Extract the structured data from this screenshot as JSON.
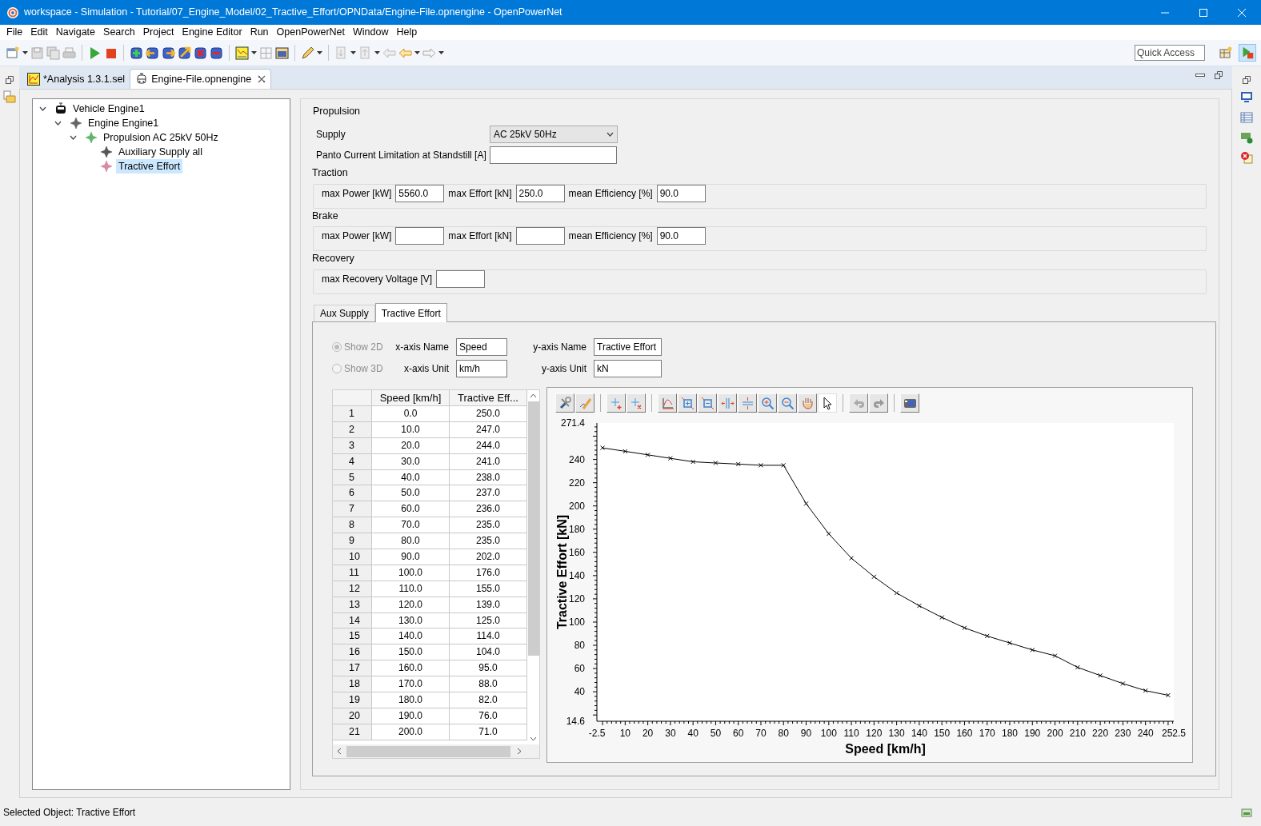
{
  "window": {
    "title": "workspace - Simulation - Tutorial/07_Engine_Model/02_Tractive_Effort/OPNData/Engine-File.opnengine - OpenPowerNet"
  },
  "menu": [
    "File",
    "Edit",
    "Navigate",
    "Search",
    "Project",
    "Engine Editor",
    "Run",
    "OpenPowerNet",
    "Window",
    "Help"
  ],
  "quick_access": {
    "placeholder": "Quick Access"
  },
  "editor_tabs": [
    {
      "label": "*Analysis 1.3.1.sel",
      "kind": "analysis",
      "selected": false
    },
    {
      "label": "Engine-File.opnengine",
      "kind": "engine",
      "selected": true
    }
  ],
  "tree": [
    {
      "label": "Vehicle Engine1",
      "kind": "vehicle",
      "expanded": true,
      "selected": false,
      "children": [
        {
          "label": "Engine Engine1",
          "kind": "engine",
          "expanded": true,
          "selected": false,
          "children": [
            {
              "label": "Propulsion AC 25kV 50Hz",
              "kind": "propulsion",
              "expanded": true,
              "selected": false,
              "children": [
                {
                  "label": "Auxiliary Supply all",
                  "kind": "auxiliary",
                  "selected": false
                },
                {
                  "label": "Tractive Effort",
                  "kind": "tractive",
                  "selected": true
                }
              ]
            }
          ]
        }
      ]
    }
  ],
  "form": {
    "title": "Propulsion",
    "supply": {
      "label": "Supply",
      "value": "AC 25kV 50Hz"
    },
    "panto": {
      "label": "Panto Current Limitation at Standstill [A]"
    },
    "groups": [
      {
        "title": "Traction",
        "fields": [
          {
            "label": "max Power [kW]",
            "value": "5560.0"
          },
          {
            "label": "max Effort [kN]",
            "value": "250.0"
          },
          {
            "label": "mean Efficiency [%]",
            "value": "90.0"
          }
        ]
      },
      {
        "title": "Brake",
        "fields": [
          {
            "label": "max Power [kW]"
          },
          {
            "label": "max Effort [kN]"
          },
          {
            "label": "mean Efficiency [%]",
            "value": "90.0"
          }
        ]
      },
      {
        "title": "Recovery",
        "fields": [
          {
            "label": "max Recovery Voltage [V]"
          }
        ]
      }
    ]
  },
  "sub_tabs": [
    {
      "label": "Aux Supply",
      "selected": false
    },
    {
      "label": "Tractive Effort",
      "selected": true
    }
  ],
  "axis_settings": {
    "radios": [
      {
        "label": "Show 2D",
        "selected": true,
        "disabled": true
      },
      {
        "label": "Show 3D",
        "selected": false,
        "disabled": true
      }
    ],
    "x_name": {
      "label": "x-axis Name",
      "value": "Speed"
    },
    "y_name": {
      "label": "y-axis Name",
      "value": "Tractive Effort"
    },
    "x_unit": {
      "label": "x-axis Unit",
      "value": "km/h"
    },
    "y_unit": {
      "label": "y-axis Unit",
      "value": "kN"
    }
  },
  "table": {
    "columns": [
      "",
      "Speed [km/h]",
      "Tractive Eff..."
    ],
    "rows": [
      [
        "1",
        "0.0",
        "250.0"
      ],
      [
        "2",
        "10.0",
        "247.0"
      ],
      [
        "3",
        "20.0",
        "244.0"
      ],
      [
        "4",
        "30.0",
        "241.0"
      ],
      [
        "5",
        "40.0",
        "238.0"
      ],
      [
        "6",
        "50.0",
        "237.0"
      ],
      [
        "7",
        "60.0",
        "236.0"
      ],
      [
        "8",
        "70.0",
        "235.0"
      ],
      [
        "9",
        "80.0",
        "235.0"
      ],
      [
        "10",
        "90.0",
        "202.0"
      ],
      [
        "11",
        "100.0",
        "176.0"
      ],
      [
        "12",
        "110.0",
        "155.0"
      ],
      [
        "13",
        "120.0",
        "139.0"
      ],
      [
        "14",
        "130.0",
        "125.0"
      ],
      [
        "15",
        "140.0",
        "114.0"
      ],
      [
        "16",
        "150.0",
        "104.0"
      ],
      [
        "17",
        "160.0",
        "95.0"
      ],
      [
        "18",
        "170.0",
        "88.0"
      ],
      [
        "19",
        "180.0",
        "82.0"
      ],
      [
        "20",
        "190.0",
        "76.0"
      ],
      [
        "21",
        "200.0",
        "71.0"
      ]
    ]
  },
  "chart": {
    "chart_data": {
      "type": "line",
      "xlabel": "Speed [km/h]",
      "ylabel": "Tractive Effort [kN]",
      "x": [
        0,
        10,
        20,
        30,
        40,
        50,
        60,
        70,
        80,
        90,
        100,
        110,
        120,
        130,
        140,
        150,
        160,
        170,
        180,
        190,
        200,
        210,
        220,
        230,
        240,
        250
      ],
      "series": [
        {
          "color": "#000000",
          "marker": "x",
          "values": [
            250,
            247,
            244,
            241,
            238,
            237,
            236,
            235,
            235,
            202,
            176,
            155,
            139,
            125,
            114,
            104,
            95,
            88,
            82,
            76,
            71,
            61,
            54,
            47,
            41,
            37
          ]
        }
      ],
      "xlim": [
        -2.5,
        252.5
      ],
      "ylim": [
        14.6,
        271.4
      ],
      "xticks": [
        -2.5,
        10,
        20,
        30,
        40,
        50,
        60,
        70,
        80,
        90,
        100,
        110,
        120,
        130,
        140,
        150,
        160,
        170,
        180,
        190,
        200,
        210,
        220,
        230,
        240,
        252.5
      ],
      "yticks": [
        14.6,
        40,
        60,
        80,
        100,
        120,
        140,
        160,
        180,
        200,
        220,
        240,
        271.4
      ]
    }
  },
  "status_bar": {
    "text": "Selected Object: Tractive Effort"
  }
}
